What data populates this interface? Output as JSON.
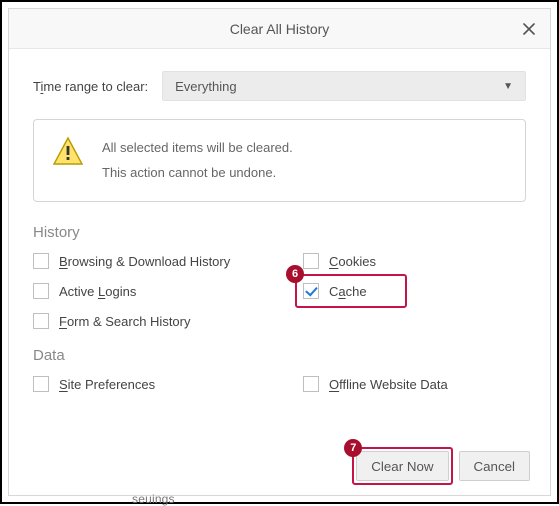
{
  "dialog": {
    "title": "Clear All History",
    "close_aria": "Close"
  },
  "range": {
    "label_pre": "T",
    "label_u": "i",
    "label_post": "me range to clear:",
    "selected": "Everything"
  },
  "alert": {
    "line1": "All selected items will be cleared.",
    "line2": "This action cannot be undone."
  },
  "sections": {
    "history": "History",
    "data": "Data"
  },
  "checks": {
    "browsing": {
      "u": "B",
      "rest": "rowsing & Download History",
      "checked": false
    },
    "cookies": {
      "u": "C",
      "rest": "ookies",
      "checked": false
    },
    "logins": {
      "pre": "Active ",
      "u": "L",
      "rest": "ogins",
      "checked": false
    },
    "cache": {
      "pre": "C",
      "u": "a",
      "rest": "che",
      "checked": true
    },
    "form": {
      "u": "F",
      "rest": "orm & Search History",
      "checked": false
    },
    "siteprefs": {
      "u": "S",
      "rest": "ite Preferences",
      "checked": false
    },
    "offline": {
      "u": "O",
      "rest": "ffline Website Data",
      "checked": false
    }
  },
  "buttons": {
    "clear": "Clear Now",
    "cancel": "Cancel"
  },
  "annotations": {
    "badge6": "6",
    "badge7": "7"
  },
  "truncated_bg": "seuings"
}
